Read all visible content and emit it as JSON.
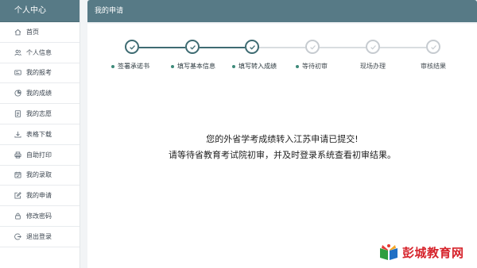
{
  "sidebar": {
    "title": "个人中心",
    "items": [
      {
        "label": "首页",
        "icon": "home-icon"
      },
      {
        "label": "个人信息",
        "icon": "users-icon"
      },
      {
        "label": "我的报考",
        "icon": "id-card-icon"
      },
      {
        "label": "我的成绩",
        "icon": "pie-chart-icon"
      },
      {
        "label": "我的志愿",
        "icon": "document-icon"
      },
      {
        "label": "表格下载",
        "icon": "download-icon"
      },
      {
        "label": "自助打印",
        "icon": "printer-icon"
      },
      {
        "label": "我的录取",
        "icon": "calendar-icon"
      },
      {
        "label": "我的申请",
        "icon": "edit-icon"
      },
      {
        "label": "修改密码",
        "icon": "lock-icon"
      },
      {
        "label": "退出登录",
        "icon": "logout-icon"
      }
    ]
  },
  "main": {
    "title": "我的申请",
    "steps": [
      {
        "label": "签署承诺书",
        "status": "done"
      },
      {
        "label": "填写基本信息",
        "status": "done"
      },
      {
        "label": "填写转入成绩",
        "status": "done"
      },
      {
        "label": "等待初审",
        "status": "todo"
      },
      {
        "label": "现场办理",
        "status": "todo"
      },
      {
        "label": "审核结果",
        "status": "todo"
      }
    ],
    "message_line1": "您的外省学考成绩转入江苏申请已提交!",
    "message_line2": "请等待省教育考试院初审，并及时登录系统查看初审结果。"
  },
  "watermark": {
    "text": "彭城教育网"
  },
  "colors": {
    "header": "#577a86",
    "done": "#3e6b72",
    "todo": "#c6cbd0",
    "watermark": "#d6222a"
  }
}
